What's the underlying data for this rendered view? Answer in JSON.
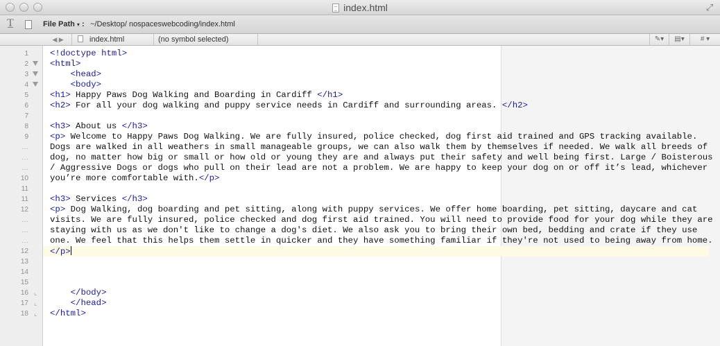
{
  "window": {
    "title": "index.html"
  },
  "toolbar": {
    "path_label": "File Path",
    "path_caret": "▾",
    "path_separator": ":",
    "path_value": "~/Desktop/  nospaceswebcoding/index.html"
  },
  "navbar": {
    "file_name": "index.html",
    "symbol": "(no symbol selected)",
    "hash": "#"
  },
  "gutter": [
    {
      "n": "1",
      "fold": ""
    },
    {
      "n": "2",
      "fold": "open"
    },
    {
      "n": "3",
      "fold": "open"
    },
    {
      "n": "4",
      "fold": "open"
    },
    {
      "n": "5",
      "fold": ""
    },
    {
      "n": "6",
      "fold": ""
    },
    {
      "n": "7",
      "fold": ""
    },
    {
      "n": "8",
      "fold": ""
    },
    {
      "n": "9",
      "fold": ""
    },
    {
      "n": "…",
      "fold": ""
    },
    {
      "n": "…",
      "fold": ""
    },
    {
      "n": "…",
      "fold": ""
    },
    {
      "n": "10",
      "fold": ""
    },
    {
      "n": "11",
      "fold": ""
    },
    {
      "n": "11",
      "fold": ""
    },
    {
      "n": "12",
      "fold": ""
    },
    {
      "n": "…",
      "fold": ""
    },
    {
      "n": "…",
      "fold": ""
    },
    {
      "n": "…",
      "fold": ""
    },
    {
      "n": "12",
      "fold": ""
    },
    {
      "n": "13",
      "fold": ""
    },
    {
      "n": "14",
      "fold": ""
    },
    {
      "n": "15",
      "fold": ""
    },
    {
      "n": "16",
      "fold": "end"
    },
    {
      "n": "17",
      "fold": "end"
    },
    {
      "n": "18",
      "fold": "end"
    }
  ],
  "code_lines": [
    [
      [
        "tag",
        "<!doctype html>"
      ]
    ],
    [
      [
        "tag",
        "<html>"
      ]
    ],
    [
      [
        "txt",
        "    "
      ],
      [
        "tag",
        "<head>"
      ]
    ],
    [
      [
        "txt",
        "    "
      ],
      [
        "tag",
        "<body>"
      ]
    ],
    [
      [
        "tag",
        "<h1>"
      ],
      [
        "txt",
        " Happy Paws Dog Walking and Boarding in Cardiff "
      ],
      [
        "tag",
        "</h1>"
      ]
    ],
    [
      [
        "tag",
        "<h2>"
      ],
      [
        "txt",
        " For all your dog walking and puppy service needs in Cardiff and surrounding areas. "
      ],
      [
        "tag",
        "</h2>"
      ]
    ],
    [],
    [
      [
        "tag",
        "<h3>"
      ],
      [
        "txt",
        " About us "
      ],
      [
        "tag",
        "</h3>"
      ]
    ],
    [
      [
        "tag",
        "<p>"
      ],
      [
        "txt",
        " Welcome to Happy Paws Dog Walking. We are fully insured, police checked, dog first aid trained and GPS tracking available."
      ]
    ],
    [
      [
        "txt",
        "Dogs are walked in all weathers in small manageable groups, we can also walk them by themselves if needed. We walk all breeds of"
      ]
    ],
    [
      [
        "txt",
        "dog, no matter how big or small or how old or young they are and always put their safety and well being first. Large / Boisterous"
      ]
    ],
    [
      [
        "txt",
        "/ Aggressive Dogs or dogs who pull on their lead are not a problem. We are happy to keep your dog on or off it’s lead, whichever"
      ]
    ],
    [
      [
        "txt",
        "you’re more comfortable with."
      ],
      [
        "tag",
        "</p>"
      ]
    ],
    [],
    [
      [
        "tag",
        "<h3>"
      ],
      [
        "txt",
        " Services "
      ],
      [
        "tag",
        "</h3>"
      ]
    ],
    [
      [
        "tag",
        "<p>"
      ],
      [
        "txt",
        " Dog Walking, dog boarding and pet sitting, along with puppy services. We offer home boarding, pet sitting, daycare and cat"
      ]
    ],
    [
      [
        "txt",
        "visits. We are fully insured, police checked and dog first aid trained. You will need to provide food for your dog while they are"
      ]
    ],
    [
      [
        "txt",
        "staying with us as we don't like to change a dog's diet. We also ask you to bring their own bed, bedding and crate if they use"
      ]
    ],
    [
      [
        "txt",
        "one. We feel that this helps them settle in quicker and they have something familiar if they're not used to being away from home."
      ]
    ],
    [
      [
        "tag",
        "</p>"
      ],
      [
        "cursor",
        ""
      ]
    ],
    [],
    [],
    [],
    [
      [
        "txt",
        "    "
      ],
      [
        "tag",
        "</body>"
      ]
    ],
    [
      [
        "txt",
        "    "
      ],
      [
        "tag",
        "</head>"
      ]
    ],
    [
      [
        "tag",
        "</html>"
      ]
    ]
  ]
}
